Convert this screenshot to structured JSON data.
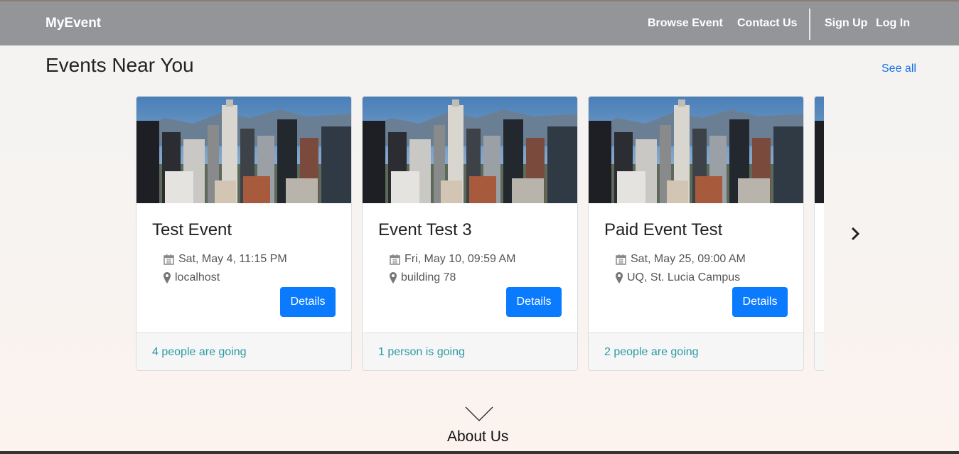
{
  "nav": {
    "brand": "MyEvent",
    "links": [
      "Browse Event",
      "Contact Us",
      "Sign Up",
      "Log In"
    ]
  },
  "events_section": {
    "title": "Events Near You",
    "see_all": "See all"
  },
  "cards": [
    {
      "title": "Test Event",
      "date": "Sat, May 4, 11:15 PM",
      "location": "localhost",
      "button": "Details",
      "going": "4 people are going"
    },
    {
      "title": "Event Test 3",
      "date": "Fri, May 10, 09:59 AM",
      "location": "building 78",
      "button": "Details",
      "going": "1 person is going"
    },
    {
      "title": "Paid Event Test",
      "date": "Sat, May 25, 09:00 AM",
      "location": "UQ, St. Lucia Campus",
      "button": "Details",
      "going": "2 people are going"
    }
  ],
  "about": {
    "title": "About Us"
  },
  "colors": {
    "navbar": "#939598",
    "accent": "#0a7bff",
    "going": "#2a9aa5"
  },
  "icons": [
    "calendar-icon",
    "map-marker-icon",
    "chevron-right-icon",
    "chevron-down-icon"
  ]
}
